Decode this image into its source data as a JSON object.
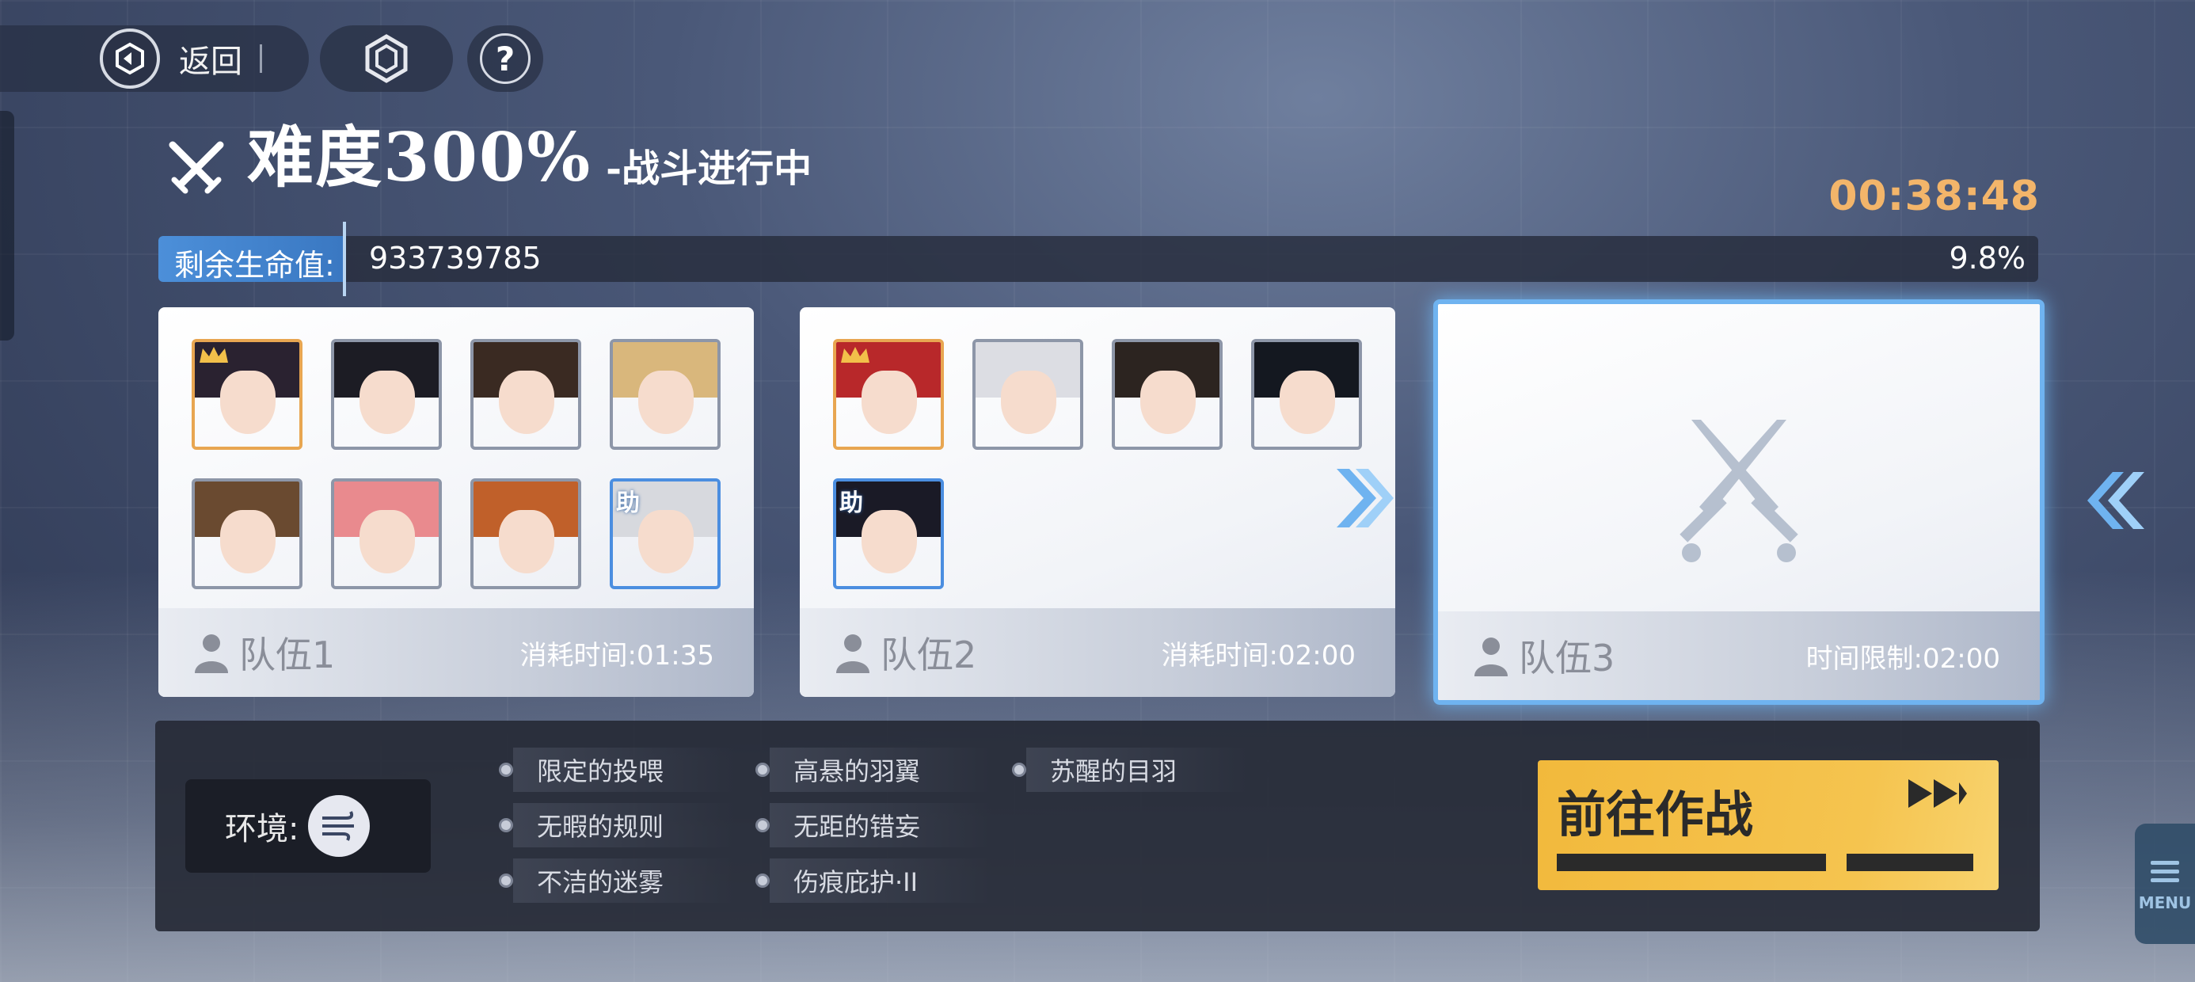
{
  "nav": {
    "back_label": "返回"
  },
  "title": {
    "main": "难度300%",
    "sub": "-战斗进行中"
  },
  "timer": "00:38:48",
  "hp": {
    "label": "剩余生命值:",
    "value": "933739785",
    "percent_text": "9.8%",
    "percent": 9.8
  },
  "teams": [
    {
      "name": "队伍1",
      "time_label": "消耗时间:01:35",
      "support_tag": "助"
    },
    {
      "name": "队伍2",
      "time_label": "消耗时间:02:00",
      "support_tag": "助"
    },
    {
      "name": "队伍3",
      "time_label": "时间限制:02:00"
    }
  ],
  "environment": {
    "label": "环境:"
  },
  "buffs": [
    "限定的投喂",
    "高悬的羽翼",
    "苏醒的目羽",
    "无暇的规则",
    "无距的错妄",
    "不洁的迷雾",
    "伤痕庇护·II"
  ],
  "go_button": {
    "label": "前往作战"
  },
  "menu_button": {
    "label": "MENU"
  },
  "colors": {
    "accent_blue": "#4c8fd9",
    "timer_orange": "#f3b56a",
    "go_yellow": "#f2b93c",
    "leader_border": "#e8a651",
    "support_border": "#4b8ee0"
  }
}
